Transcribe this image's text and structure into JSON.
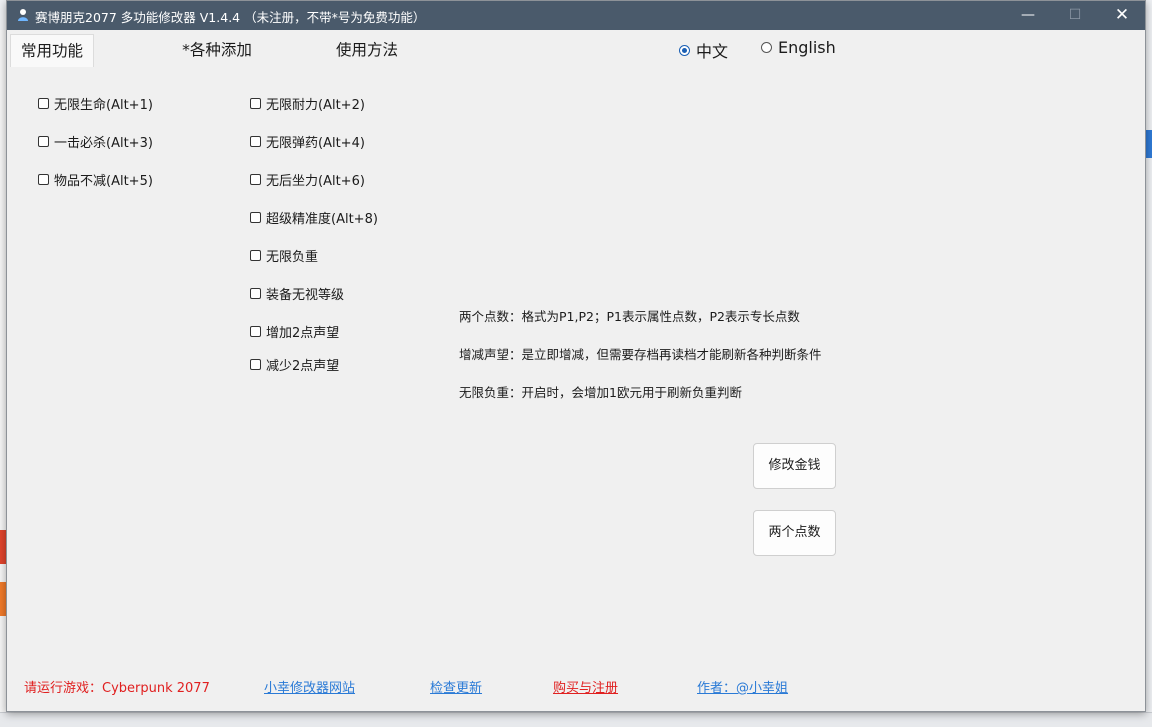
{
  "window": {
    "title": "赛博朋克2077 多功能修改器  V1.4.4  （未注册，不带*号为免费功能）",
    "controls": {
      "minimize": "—",
      "maximize": "☐",
      "close": "✕"
    }
  },
  "tabs": [
    {
      "label": "常用功能",
      "active": true
    },
    {
      "label": "*各种添加",
      "active": false
    },
    {
      "label": "使用方法",
      "active": false
    }
  ],
  "language": {
    "options": [
      {
        "label": "中文",
        "selected": true
      },
      {
        "label": "English",
        "selected": false
      }
    ]
  },
  "cheats_left": [
    {
      "label": "无限生命(Alt+1)",
      "checked": false
    },
    {
      "label": "一击必杀(Alt+3)",
      "checked": false
    },
    {
      "label": "物品不减(Alt+5)",
      "checked": false
    }
  ],
  "cheats_right": [
    {
      "label": "无限耐力(Alt+2)",
      "checked": false
    },
    {
      "label": "无限弹药(Alt+4)",
      "checked": false
    },
    {
      "label": "无后坐力(Alt+6)",
      "checked": false
    },
    {
      "label": "超级精准度(Alt+8)",
      "checked": false
    },
    {
      "label": "无限负重",
      "checked": false
    },
    {
      "label": "装备无视等级",
      "checked": false
    },
    {
      "label": "增加2点声望",
      "checked": false
    },
    {
      "label": "减少2点声望",
      "checked": false
    }
  ],
  "info": [
    "两个点数：格式为P1,P2；P1表示属性点数，P2表示专长点数",
    "增减声望：是立即增减，但需要存档再读档才能刷新各种判断条件",
    "无限负重：开启时，会增加1欧元用于刷新负重判断"
  ],
  "buttons": {
    "modify_money": "修改金钱",
    "two_points": "两个点数"
  },
  "footer": {
    "run_game": "请运行游戏：Cyberpunk 2077",
    "site_link": "小幸修改器网站",
    "update_link": "检查更新",
    "buy_link": "购买与注册",
    "author_link": "作者：@小幸姐"
  },
  "colors": {
    "titlebar": "#4a5a6b",
    "window_bg": "#f0f0f0",
    "link_blue": "#2a7ad6",
    "link_red": "#e02020",
    "radio_accent": "#1a5fb4"
  }
}
